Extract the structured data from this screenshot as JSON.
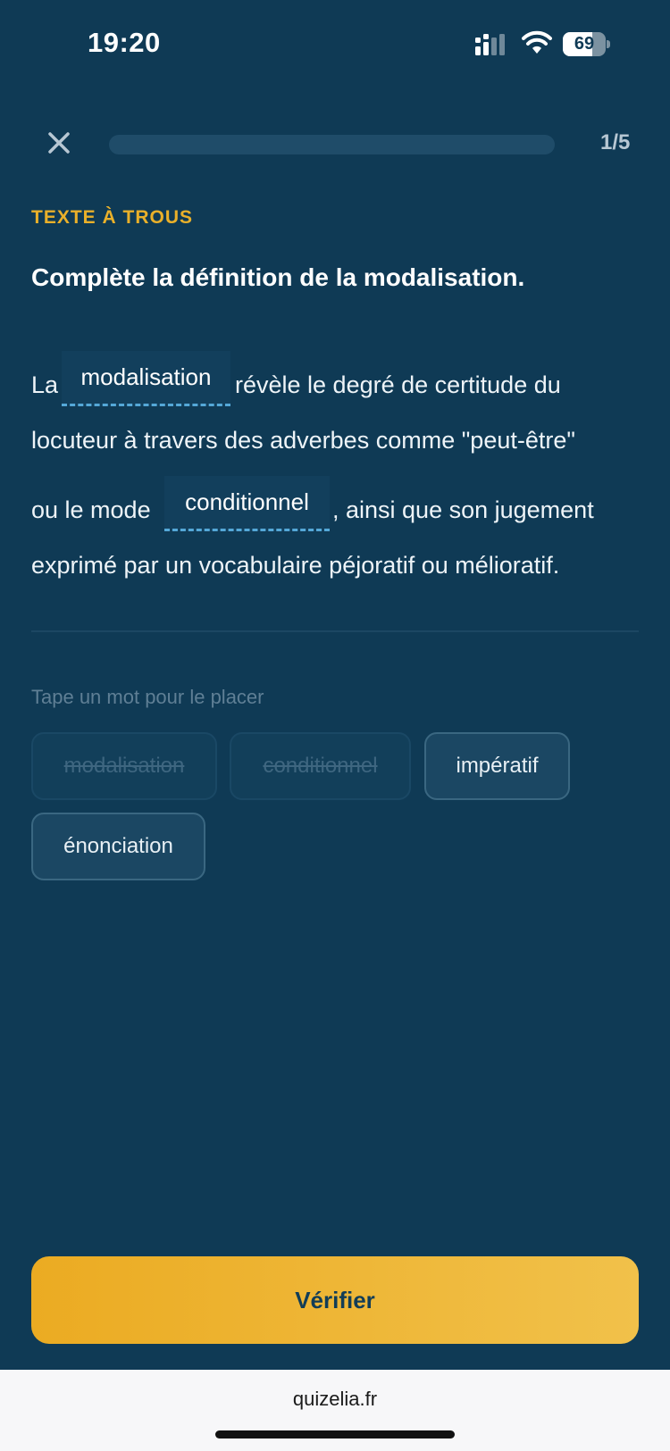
{
  "status_bar": {
    "time": "19:20",
    "battery_level": "69",
    "battery_fraction": 0.69,
    "icons": [
      "signal-icon",
      "wifi-icon",
      "battery-icon"
    ]
  },
  "quiz_header": {
    "close_icon": "close-icon",
    "progress_label": "1/5",
    "progress_fraction": 0.0,
    "progress_color": "#e9b02a"
  },
  "exercise": {
    "type_label": "TEXTE À TROUS",
    "prompt": "Complète la définition de la modalisation.",
    "sentence": {
      "line1_before": "La",
      "blank1": "modalisation",
      "line1_after": "révèle le degré de certitude du",
      "line2": "locuteur à travers des adverbes comme \"peut-être\"",
      "line3_before": "ou le mode",
      "blank2": "conditionnel",
      "line3_after": ", ainsi que son jugement",
      "line4": "exprimé par un vocabulaire péjoratif ou mélioratif."
    }
  },
  "word_bank": {
    "hint": "Tape un mot pour le placer",
    "chips": [
      {
        "label": "modalisation",
        "used": true
      },
      {
        "label": "conditionnel",
        "used": true
      },
      {
        "label": "impératif",
        "used": false
      },
      {
        "label": "énonciation",
        "used": false
      }
    ]
  },
  "actions": {
    "verify_label": "Vérifier",
    "accent_color": "#e9b02a"
  },
  "browser": {
    "url": "quizelia.fr"
  },
  "colors": {
    "background": "#0f3a55",
    "accent": "#e9b02a",
    "blank_underline": "#55a8d8"
  }
}
